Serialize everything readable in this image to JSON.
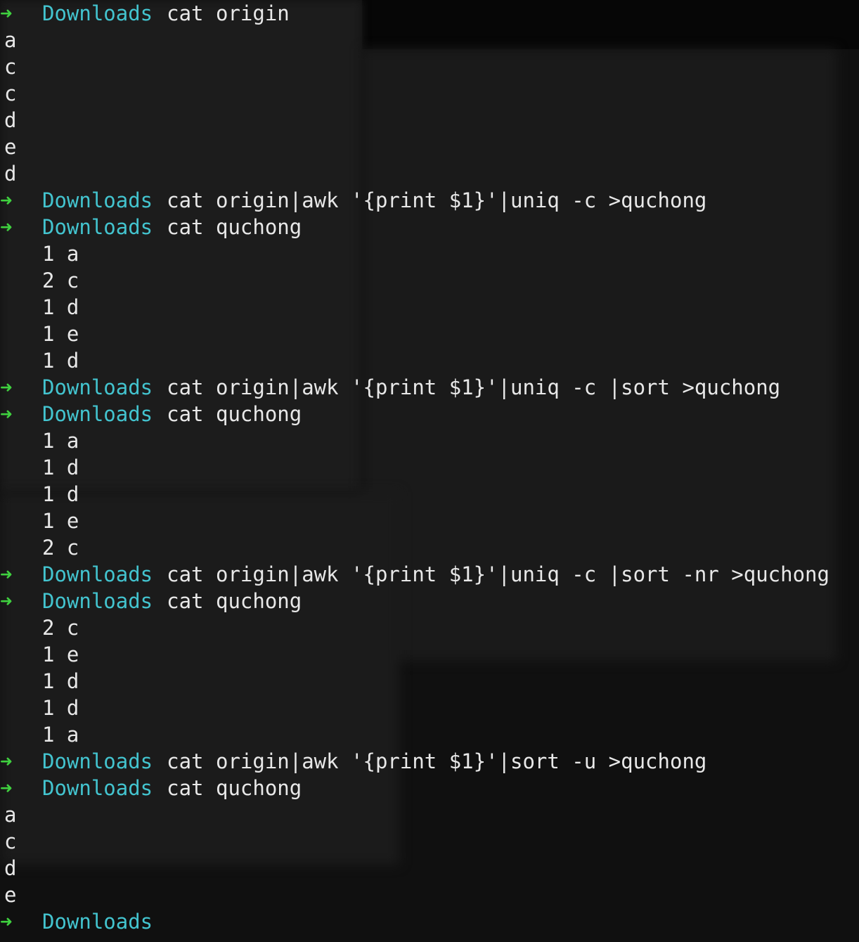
{
  "prompt": {
    "arrow": "➜",
    "directory": "Downloads"
  },
  "colors": {
    "arrow": "#3fd13f",
    "directory": "#43c4cf",
    "text": "#e8e8e8",
    "background": "#101010"
  },
  "lines": [
    {
      "type": "prompt",
      "command": "cat origin"
    },
    {
      "type": "output",
      "text": "a"
    },
    {
      "type": "output",
      "text": "c"
    },
    {
      "type": "output",
      "text": "c"
    },
    {
      "type": "output",
      "text": "d"
    },
    {
      "type": "output",
      "text": "e"
    },
    {
      "type": "output",
      "text": "d"
    },
    {
      "type": "prompt",
      "command": "cat origin|awk '{print $1}'|uniq -c >quchong"
    },
    {
      "type": "prompt",
      "command": "cat quchong"
    },
    {
      "type": "output-indent",
      "text": "1 a"
    },
    {
      "type": "output-indent",
      "text": "2 c"
    },
    {
      "type": "output-indent",
      "text": "1 d"
    },
    {
      "type": "output-indent",
      "text": "1 e"
    },
    {
      "type": "output-indent",
      "text": "1 d"
    },
    {
      "type": "prompt",
      "command": "cat origin|awk '{print $1}'|uniq -c |sort >quchong"
    },
    {
      "type": "prompt",
      "command": "cat quchong"
    },
    {
      "type": "output-indent",
      "text": "1 a"
    },
    {
      "type": "output-indent",
      "text": "1 d"
    },
    {
      "type": "output-indent",
      "text": "1 d"
    },
    {
      "type": "output-indent",
      "text": "1 e"
    },
    {
      "type": "output-indent",
      "text": "2 c"
    },
    {
      "type": "prompt",
      "command": "cat origin|awk '{print $1}'|uniq -c |sort -nr >quchong"
    },
    {
      "type": "prompt",
      "command": "cat quchong"
    },
    {
      "type": "output-indent",
      "text": "2 c"
    },
    {
      "type": "output-indent",
      "text": "1 e"
    },
    {
      "type": "output-indent",
      "text": "1 d"
    },
    {
      "type": "output-indent",
      "text": "1 d"
    },
    {
      "type": "output-indent",
      "text": "1 a"
    },
    {
      "type": "prompt",
      "command": "cat origin|awk '{print $1}'|sort -u >quchong"
    },
    {
      "type": "prompt",
      "command": "cat quchong"
    },
    {
      "type": "output",
      "text": "a"
    },
    {
      "type": "output",
      "text": "c"
    },
    {
      "type": "output",
      "text": "d"
    },
    {
      "type": "output",
      "text": "e"
    },
    {
      "type": "prompt",
      "command": ""
    }
  ]
}
